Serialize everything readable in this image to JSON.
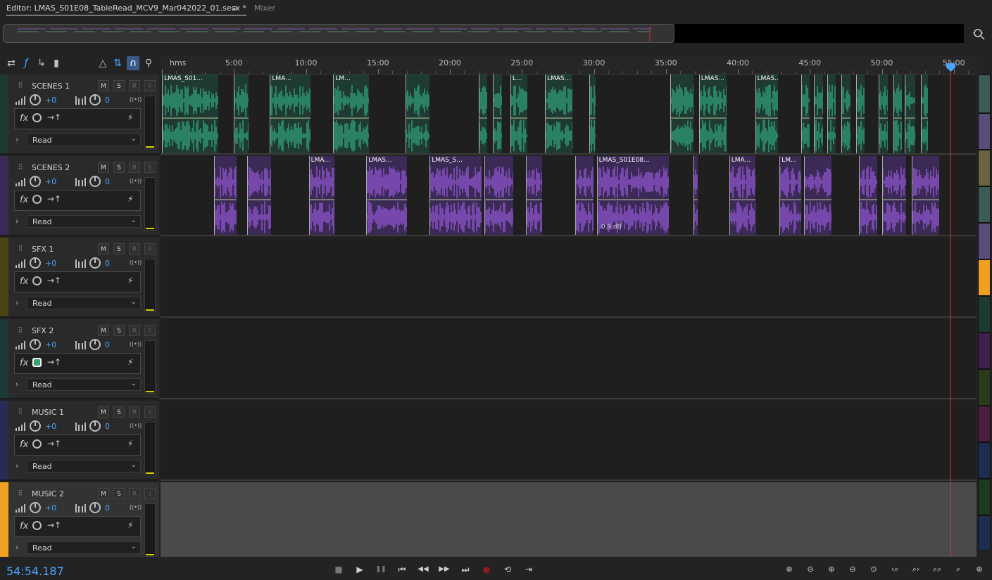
{
  "tabs": {
    "editor_label": "Editor: LMAS_S01E08_TableRead_MCV9_Mar042022_01.sesx *",
    "menu_icon": "≡",
    "mixer_label": "Mixer"
  },
  "ruler": {
    "unit_label": "hms",
    "labels": [
      "5:00",
      "10:00",
      "15:00",
      "20:00",
      "25:00",
      "30:00",
      "35:00",
      "40:00",
      "45:00",
      "50:00",
      "55:00"
    ]
  },
  "tracks": [
    {
      "name": "SCENES 1",
      "color": "#1f3a34",
      "clip_color": "#2f9a72",
      "m": "M",
      "s": "S",
      "r": "R",
      "i": "I",
      "volume": "+0",
      "pan": "0",
      "fx": "fx",
      "mode": "Read",
      "fx_power_on": false
    },
    {
      "name": "SCENES 2",
      "color": "#3a2a55",
      "clip_color": "#8a52c8",
      "m": "M",
      "s": "S",
      "r": "R",
      "i": "I",
      "volume": "+0",
      "pan": "0",
      "fx": "fx",
      "mode": "Read",
      "fx_power_on": false
    },
    {
      "name": "SFX 1",
      "color": "#4a4512",
      "clip_color": "#6a6a1a",
      "m": "M",
      "s": "S",
      "r": "R",
      "i": "I",
      "volume": "+0",
      "pan": "0",
      "fx": "fx",
      "mode": "Read",
      "fx_power_on": false
    },
    {
      "name": "SFX 2",
      "color": "#1e3a36",
      "clip_color": "#2a5a50",
      "m": "M",
      "s": "S",
      "r": "R",
      "i": "I",
      "volume": "+0",
      "pan": "0",
      "fx": "fx",
      "mode": "Read",
      "fx_power_on": true
    },
    {
      "name": "MUSIC 1",
      "color": "#2a2a55",
      "clip_color": "#4a4a8a",
      "m": "M",
      "s": "S",
      "r": "R",
      "i": "I",
      "volume": "+0",
      "pan": "0",
      "fx": "fx",
      "mode": "Read",
      "fx_power_on": false
    },
    {
      "name": "MUSIC 2",
      "color": "#f0a020",
      "clip_color": "#f0a020",
      "m": "M",
      "s": "S",
      "r": "R",
      "i": "I",
      "volume": "+0",
      "pan": "0",
      "fx": "fx",
      "mode": "Read",
      "fx_power_on": false
    }
  ],
  "clips_track1": [
    {
      "label": "LMAS_S01...",
      "start_min": 0.0,
      "end_min": 3.9
    },
    {
      "label": "",
      "start_min": 5.0,
      "end_min": 6.0
    },
    {
      "label": "LMA...",
      "start_min": 7.5,
      "end_min": 10.3
    },
    {
      "label": "LM...",
      "start_min": 11.9,
      "end_min": 14.4
    },
    {
      "label": "",
      "start_min": 16.9,
      "end_min": 18.6
    },
    {
      "label": "",
      "start_min": 22.0,
      "end_min": 22.6
    },
    {
      "label": "",
      "start_min": 23.0,
      "end_min": 23.6
    },
    {
      "label": "L...",
      "start_min": 24.2,
      "end_min": 25.4
    },
    {
      "label": "LMAS...",
      "start_min": 26.6,
      "end_min": 28.5
    },
    {
      "label": "",
      "start_min": 29.7,
      "end_min": 30.1
    },
    {
      "label": "",
      "start_min": 35.3,
      "end_min": 36.9
    },
    {
      "label": "LMAS...",
      "start_min": 37.3,
      "end_min": 39.2
    },
    {
      "label": "LMAS...",
      "start_min": 41.2,
      "end_min": 42.8
    },
    {
      "label": "",
      "start_min": 44.4,
      "end_min": 45.0
    },
    {
      "label": "",
      "start_min": 45.3,
      "end_min": 45.9
    },
    {
      "label": "",
      "start_min": 46.2,
      "end_min": 46.8
    },
    {
      "label": "",
      "start_min": 47.2,
      "end_min": 47.8
    },
    {
      "label": "",
      "start_min": 48.2,
      "end_min": 48.8
    },
    {
      "label": "",
      "start_min": 49.8,
      "end_min": 50.4
    },
    {
      "label": "",
      "start_min": 50.8,
      "end_min": 51.4
    },
    {
      "label": "",
      "start_min": 51.6,
      "end_min": 52.3
    },
    {
      "label": "",
      "start_min": 52.7,
      "end_min": 53.2
    }
  ],
  "clips_track2": [
    {
      "label": "",
      "start_min": 3.6,
      "end_min": 5.2
    },
    {
      "label": "",
      "start_min": 5.9,
      "end_min": 7.6
    },
    {
      "label": "LMA...",
      "start_min": 10.2,
      "end_min": 12.0
    },
    {
      "label": "LMAS...",
      "start_min": 14.2,
      "end_min": 17.0
    },
    {
      "label": "LMAS_S...",
      "start_min": 18.6,
      "end_min": 22.2
    },
    {
      "label": "",
      "start_min": 22.4,
      "end_min": 24.4
    },
    {
      "label": "",
      "start_min": 25.3,
      "end_min": 26.4
    },
    {
      "label": "",
      "start_min": 28.7,
      "end_min": 30.0
    },
    {
      "label": "LMAS_S01E08...",
      "start_min": 30.2,
      "end_min": 35.2
    },
    {
      "label": "",
      "start_min": 36.9,
      "end_min": 37.2
    },
    {
      "label": "LMA...",
      "start_min": 39.4,
      "end_min": 41.2
    },
    {
      "label": "LM...",
      "start_min": 42.9,
      "end_min": 44.4
    },
    {
      "label": "",
      "start_min": 44.6,
      "end_min": 46.5
    },
    {
      "label": "",
      "start_min": 48.4,
      "end_min": 49.7
    },
    {
      "label": "",
      "start_min": 50.0,
      "end_min": 51.7
    },
    {
      "label": "",
      "start_min": 52.1,
      "end_min": 54.0
    }
  ],
  "clip_gain_label": "0.9 dB",
  "playhead_time": "54:54.187",
  "transport": {
    "stop": "■",
    "play": "▶",
    "pause": "❚❚",
    "to_start": "⏮",
    "rewind": "◀◀",
    "forward": "▶▶",
    "to_end": "⏭",
    "record": "●",
    "loop": "⟲",
    "skip": "⇥"
  },
  "zoom_icons": [
    "zoom-in-amplitude",
    "zoom-out-amplitude",
    "zoom-in",
    "zoom-out",
    "zoom-selection",
    "zoom-in-left",
    "zoom-in-right",
    "zoom-in-playhead",
    "zoom-out-full",
    "zoom-tracks"
  ],
  "colorstrip": [
    "#3c5a56",
    "#5a4c7a",
    "#6a6440",
    "#3c5a56",
    "#5a4c7a",
    "#f0a020",
    "#1c3a30",
    "#3e1f50",
    "#2c3a1c",
    "#4a1e3c",
    "#1c2e50",
    "#1c3a1c",
    "#1c2e50"
  ]
}
